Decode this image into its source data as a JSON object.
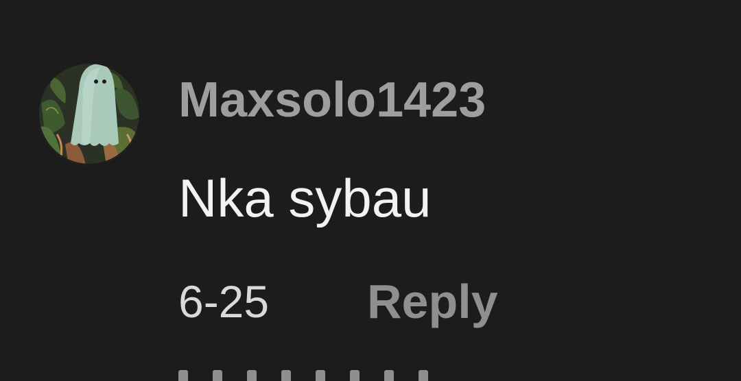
{
  "comment": {
    "username": "Maxsolo1423",
    "text": "Nka sybau",
    "date": "6-25",
    "reply_label": "Reply",
    "avatar_icon": "ghost-avatar-icon"
  },
  "colors": {
    "background": "#1c1c1c",
    "username": "#9e9e9e",
    "text": "#f2f2f2",
    "date": "#d9d9d9",
    "reply": "#8f8f8f"
  }
}
